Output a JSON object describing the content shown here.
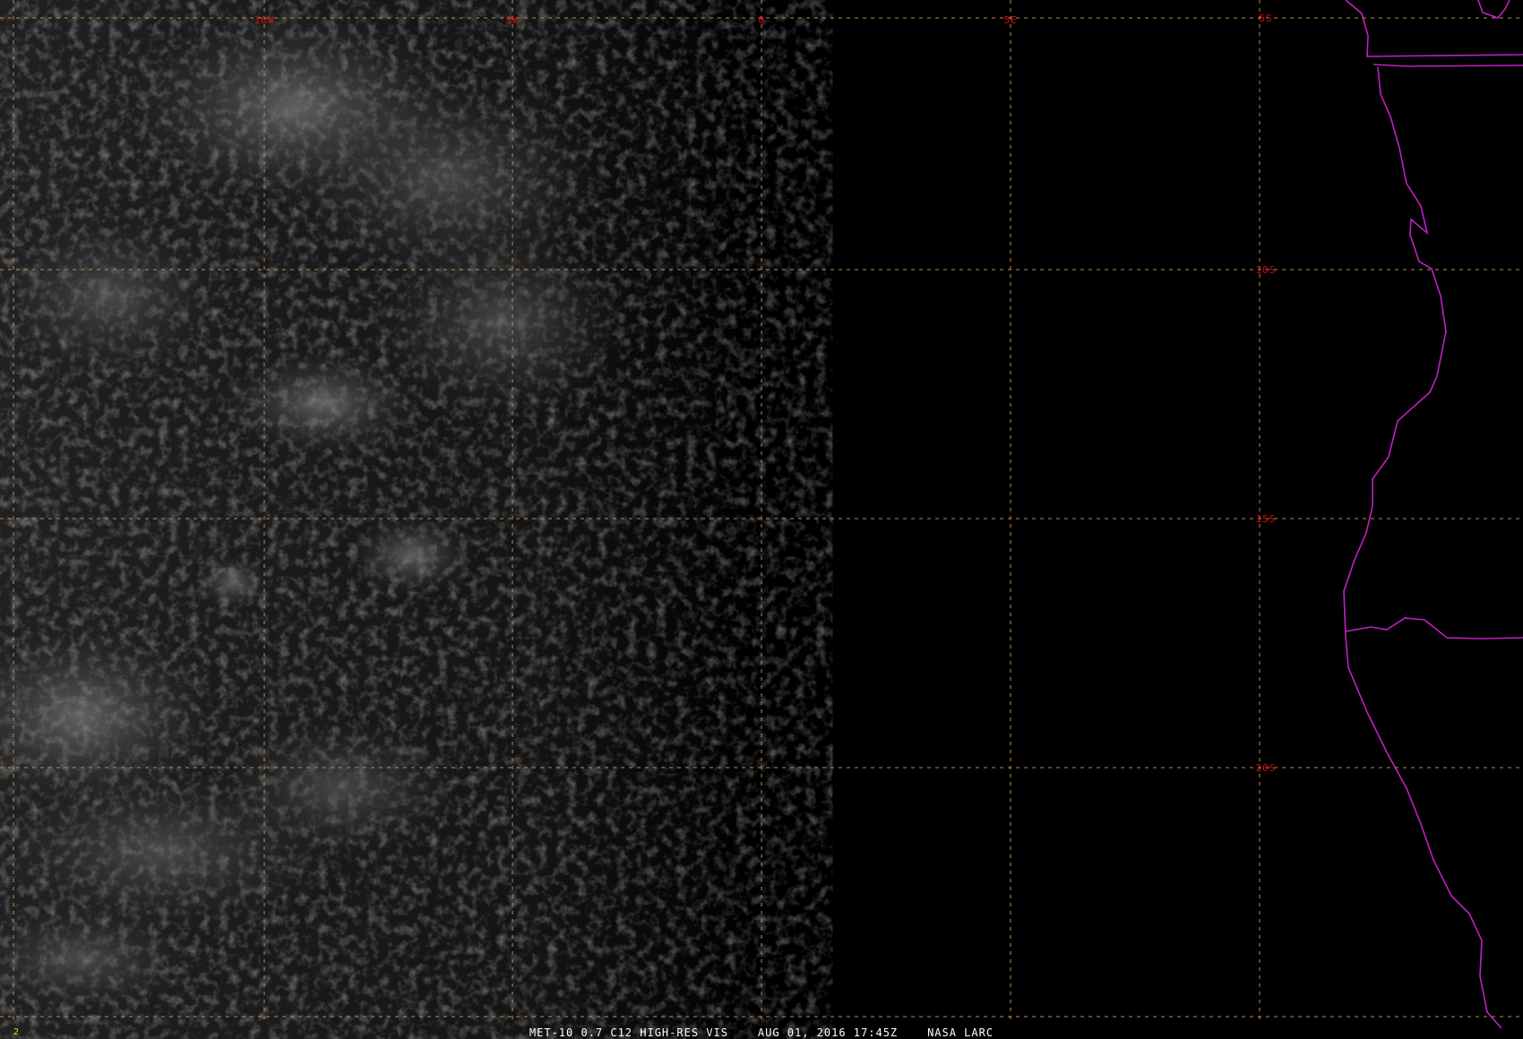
{
  "caption": {
    "product": "MET-10 0.7 C12 HIGH-RES VIS",
    "datetime": "AUG 01, 2016 17:45Z",
    "source": "NASA LARC"
  },
  "frame_number": "2",
  "longitude_labels": [
    "10W",
    "5W",
    "0",
    "5E"
  ],
  "latitude_labels": [
    "5S",
    "10S",
    "15S",
    "20S"
  ],
  "colors": {
    "grid": "#c98a4a",
    "grid_label": "#d01010",
    "coastline": "#c020c0",
    "caption_text": "#ffffff",
    "frame_number": "#e8e000",
    "background": "#000000"
  }
}
